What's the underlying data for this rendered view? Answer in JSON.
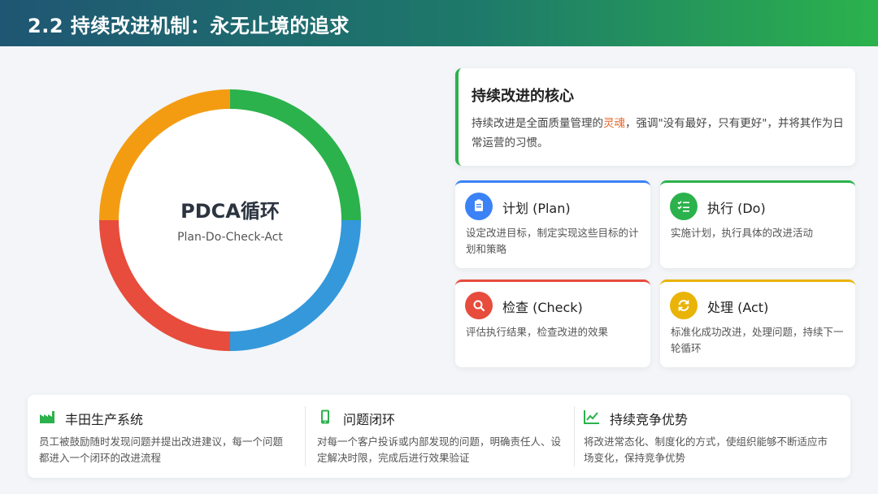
{
  "header": {
    "title": "2.2 持续改进机制：永无止境的追求"
  },
  "cycle": {
    "title": "PDCA循环",
    "subtitle": "Plan-Do-Check-Act",
    "colors": [
      "#2bb24c",
      "#3498db",
      "#e74c3c",
      "#f39c12"
    ]
  },
  "core": {
    "title": "持续改进的核心",
    "desc_before": "持续改进是全面质量管理的",
    "desc_highlight": "灵魂",
    "desc_after": "，强调\"没有最好，只有更好\"，并将其作为日常运营的习惯。"
  },
  "phases": [
    {
      "title": "计划 (Plan)",
      "desc": "设定改进目标，制定实现这些目标的计划和策略",
      "color": "#3b82f6",
      "icon": "clipboard-icon"
    },
    {
      "title": "执行 (Do)",
      "desc": "实施计划，执行具体的改进活动",
      "color": "#2bb24c",
      "icon": "list-check-icon"
    },
    {
      "title": "检查 (Check)",
      "desc": "评估执行结果，检查改进的效果",
      "color": "#e74c3c",
      "icon": "search-icon"
    },
    {
      "title": "处理 (Act)",
      "desc": "标准化成功改进，处理问题，持续下一轮循环",
      "color": "#eab308",
      "icon": "sync-icon"
    }
  ],
  "bottom": [
    {
      "title": "丰田生产系统",
      "desc": "员工被鼓励随时发现问题并提出改进建议，每一个问题都进入一个闭环的改进流程",
      "icon": "factory-icon"
    },
    {
      "title": "问题闭环",
      "desc": "对每一个客户投诉或内部发现的问题，明确责任人、设定解决时限，完成后进行效果验证",
      "icon": "mobile-icon"
    },
    {
      "title": "持续竞争优势",
      "desc": "将改进常态化、制度化的方式，使组织能够不断适应市场变化，保持竞争优势",
      "icon": "chart-line-icon"
    }
  ]
}
